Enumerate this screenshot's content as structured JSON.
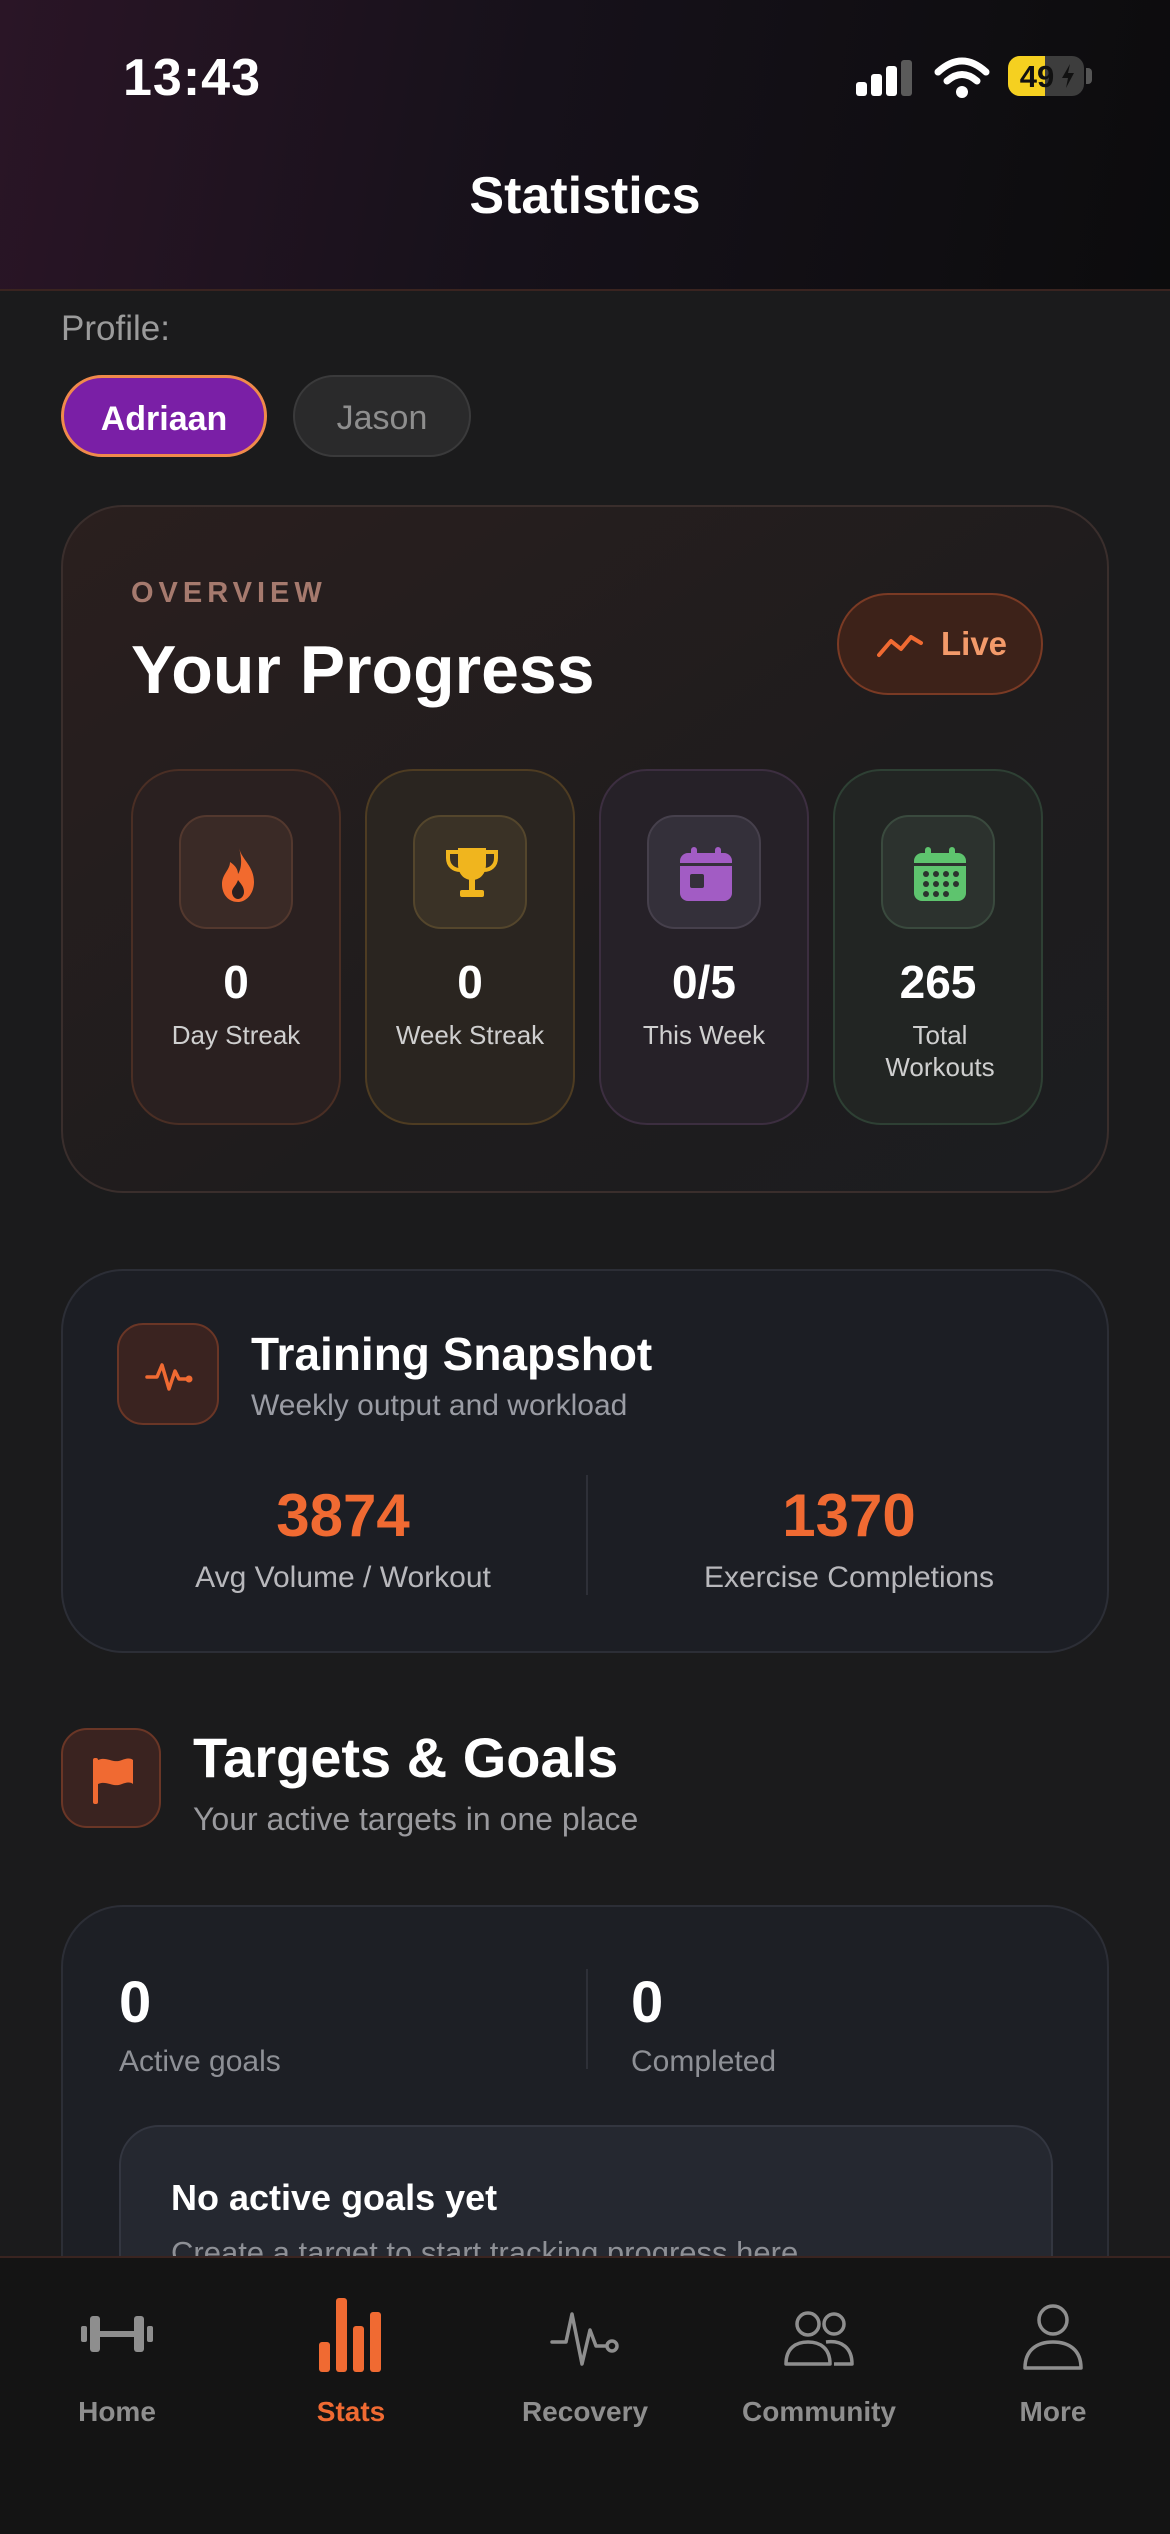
{
  "status_bar": {
    "time": "13:43",
    "battery": "49",
    "battery_level": 0.49
  },
  "header": {
    "title": "Statistics"
  },
  "profile": {
    "label": "Profile:",
    "options": [
      "Adriaan",
      "Jason"
    ],
    "selected": "Adriaan"
  },
  "overview": {
    "eyebrow": "OVERVIEW",
    "title": "Your Progress",
    "live_label": "Live",
    "stats": [
      {
        "value": "0",
        "label": "Day Streak",
        "icon": "flame-icon",
        "color": "#f26a2e"
      },
      {
        "value": "0",
        "label": "Week Streak",
        "icon": "trophy-icon",
        "color": "#f0b51e"
      },
      {
        "value": "0/5",
        "label": "This Week",
        "icon": "calendar-icon",
        "color": "#a25cc4"
      },
      {
        "value": "265",
        "label": "Total Workouts",
        "icon": "calendar-grid-icon",
        "color": "#5ec46e"
      }
    ]
  },
  "snapshot": {
    "title": "Training Snapshot",
    "subtitle": "Weekly output and workload",
    "metrics": [
      {
        "value": "3874",
        "label": "Avg Volume / Workout"
      },
      {
        "value": "1370",
        "label": "Exercise Completions"
      }
    ]
  },
  "goals": {
    "title": "Targets & Goals",
    "subtitle": "Your active targets in one place",
    "metrics": [
      {
        "value": "0",
        "label": "Active goals"
      },
      {
        "value": "0",
        "label": "Completed"
      }
    ],
    "empty_title": "No active goals yet",
    "empty_subtitle": "Create a target to start tracking progress here"
  },
  "tabbar": {
    "active": "Stats",
    "items": [
      {
        "label": "Home",
        "icon": "dumbbell-icon"
      },
      {
        "label": "Stats",
        "icon": "bar-chart-icon"
      },
      {
        "label": "Recovery",
        "icon": "pulse-icon"
      },
      {
        "label": "Community",
        "icon": "people-icon"
      },
      {
        "label": "More",
        "icon": "person-icon"
      }
    ]
  },
  "colors": {
    "accent": "#f06a32",
    "profile_active": "#7a1fa6",
    "background": "#1b1b1c"
  }
}
